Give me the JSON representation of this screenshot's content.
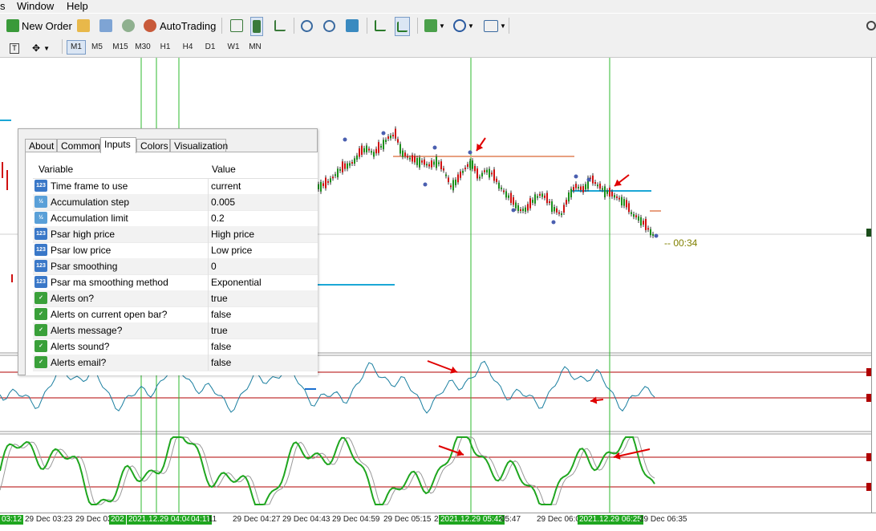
{
  "menu": {
    "partial_left": "s",
    "window": "Window",
    "help": "Help"
  },
  "toolbar": {
    "new_order": "New Order",
    "autotrading": "AutoTrading"
  },
  "timeframes": [
    "M1",
    "M5",
    "M15",
    "M30",
    "H1",
    "H4",
    "D1",
    "W1",
    "MN"
  ],
  "active_timeframe": "M1",
  "chart": {
    "countdown": "-- 00:34",
    "time_labels": [
      {
        "text": "03:12",
        "hl": true
      },
      {
        "text": "29 Dec 03:23",
        "hl": false
      },
      {
        "text": "29 Dec 03:",
        "hl": false
      },
      {
        "text": "202",
        "hl": true
      },
      {
        "text": "2021.12.29 04:04",
        "hl": true
      },
      {
        "text": "04:11",
        "hl": true
      },
      {
        "text": ":11",
        "hl": false
      },
      {
        "text": "29 Dec 04:27",
        "hl": false
      },
      {
        "text": "29 Dec 04:43",
        "hl": false
      },
      {
        "text": "29 Dec 04:59",
        "hl": false
      },
      {
        "text": "29 Dec 05:15",
        "hl": false
      },
      {
        "text": "2",
        "hl": false
      },
      {
        "text": "2021.12.29 05:42",
        "hl": true
      },
      {
        "text": "05:47",
        "hl": false
      },
      {
        "text": "29 Dec 06:0",
        "hl": false
      },
      {
        "text": "2021.12.29 06:25",
        "hl": true
      },
      {
        "text": "29 Dec 06:35",
        "hl": false
      }
    ]
  },
  "dialog": {
    "tabs": [
      "About",
      "Common",
      "Inputs",
      "Colors",
      "Visualization"
    ],
    "active_tab": "Inputs",
    "columns": {
      "variable": "Variable",
      "value": "Value"
    },
    "rows": [
      {
        "icon": "123",
        "variable": "Time frame to use",
        "value": "current"
      },
      {
        "icon": "v2",
        "variable": "Accumulation step",
        "value": "0.005"
      },
      {
        "icon": "v2",
        "variable": "Accumulation limit",
        "value": "0.2"
      },
      {
        "icon": "123",
        "variable": "Psar high price",
        "value": "High price"
      },
      {
        "icon": "123",
        "variable": "Psar low price",
        "value": "Low price"
      },
      {
        "icon": "123",
        "variable": "Psar smoothing",
        "value": "0"
      },
      {
        "icon": "123",
        "variable": "Psar ma smoothing method",
        "value": "Exponential"
      },
      {
        "icon": "bool",
        "variable": "Alerts on?",
        "value": "true"
      },
      {
        "icon": "bool",
        "variable": "Alerts on current open bar?",
        "value": "false"
      },
      {
        "icon": "bool",
        "variable": "Alerts message?",
        "value": "true"
      },
      {
        "icon": "bool",
        "variable": "Alerts sound?",
        "value": "false"
      },
      {
        "icon": "bool",
        "variable": "Alerts email?",
        "value": "false"
      }
    ]
  },
  "colors": {
    "bull_candle": "#1a8f1a",
    "bear_candle": "#d01010",
    "psar_dot": "#4a5fb0",
    "level_line": "#b00000",
    "vertical_marker": "#2eb82e",
    "support_line": "#1ba7d6",
    "resistance_line": "#e8a080",
    "osc_line": "#1a7fa0",
    "stoch_main": "#e65c00",
    "stoch_signal": "#1fa61f",
    "arrow": "#e00000",
    "highlight_label": "#1fa61f"
  }
}
